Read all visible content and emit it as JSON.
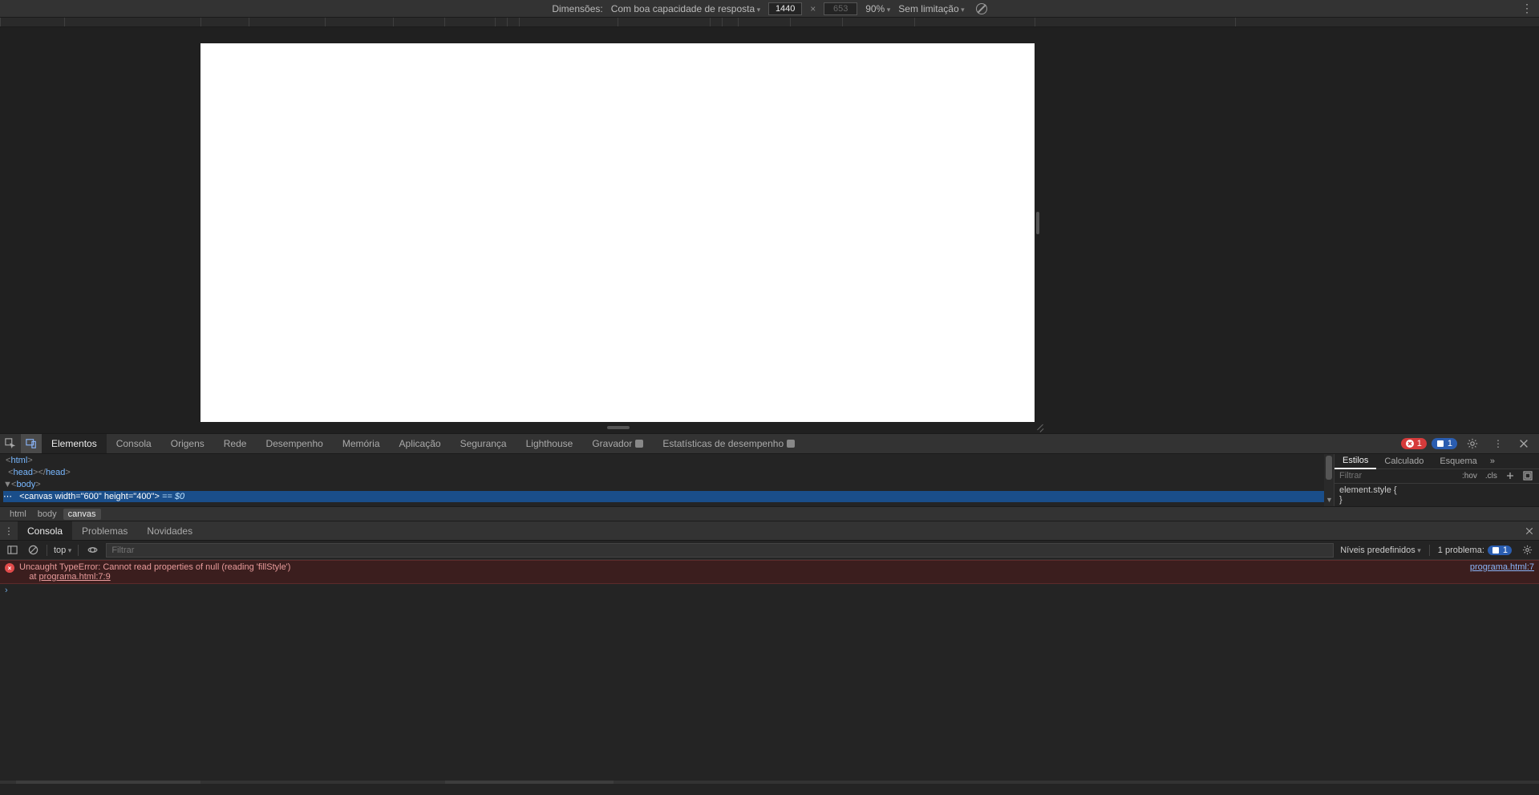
{
  "device_toolbar": {
    "dimensions_label": "Dimensões:",
    "responsive_label": "Com boa capacidade de resposta",
    "width": "1440",
    "height": "653",
    "x": "×",
    "zoom": "90%",
    "throttle": "Sem limitação"
  },
  "ruler_ticks": [
    0,
    80,
    250,
    310,
    405,
    490,
    554,
    617,
    632,
    647,
    770,
    885,
    900,
    920,
    985,
    1050,
    1140,
    1290,
    1540
  ],
  "devtools_tabs": {
    "items": [
      "Elementos",
      "Consola",
      "Origens",
      "Rede",
      "Desempenho",
      "Memória",
      "Aplicação",
      "Segurança",
      "Lighthouse",
      "Gravador",
      "Estatísticas de desempenho"
    ],
    "active": 0,
    "error_count": "1",
    "issue_count": "1"
  },
  "dom": {
    "l0": "<html>",
    "l1_open": "<head>",
    "l1_close": "</head>",
    "l2": "<body>",
    "l3_tag": "canvas",
    "l3_w_attr": "width",
    "l3_w_val": "\"600\"",
    "l3_h_attr": "height",
    "l3_h_val": "\"400\"",
    "l3_eq": " == $0"
  },
  "crumbs": {
    "items": [
      "html",
      "body",
      "canvas"
    ],
    "active": 2
  },
  "styles": {
    "tabs": [
      "Estilos",
      "Calculado",
      "Esquema"
    ],
    "active": 0,
    "filter_placeholder": "Filtrar",
    "hov": ":hov",
    "cls": ".cls",
    "rule": "element.style {",
    "rule_close": "}"
  },
  "drawer": {
    "tabs": [
      "Consola",
      "Problemas",
      "Novidades"
    ],
    "active": 0
  },
  "console_toolbar": {
    "context": "top",
    "filter_placeholder": "Filtrar",
    "levels": "Níveis predefinidos",
    "problems_label": "1 problema:",
    "problems_count": "1"
  },
  "console": {
    "error_msg": "Uncaught TypeError: Cannot read properties of null (reading 'fillStyle')",
    "error_at": "    at ",
    "error_at_link": "programa.html:7:9",
    "error_src": "programa.html:7"
  }
}
